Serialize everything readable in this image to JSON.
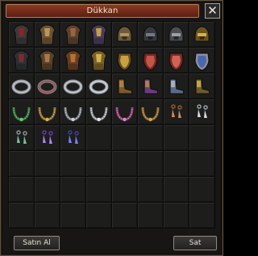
{
  "window": {
    "title": "Dükkan",
    "close_glyph": "✕"
  },
  "buttons": {
    "buy_label": "Satın Al",
    "sell_label": "Sat"
  },
  "grid": {
    "columns": 8,
    "rows": 8,
    "items": [
      {
        "name": "dark-armor-icon",
        "kind": "armor",
        "palette": [
          "#3a3a3c",
          "#a21f1f"
        ]
      },
      {
        "name": "bronze-armor-icon",
        "kind": "armor",
        "palette": [
          "#6e5332",
          "#c7a265"
        ]
      },
      {
        "name": "brown-armor-icon",
        "kind": "armor",
        "palette": [
          "#5b4130",
          "#a66c3c"
        ]
      },
      {
        "name": "gold-armor-icon",
        "kind": "armor",
        "palette": [
          "#4b3b5c",
          "#d8b04a"
        ]
      },
      {
        "name": "bronze-helmet-icon",
        "kind": "helmet",
        "palette": [
          "#6d5a3a",
          "#b99a5e"
        ]
      },
      {
        "name": "dark-helmet-icon",
        "kind": "helmet",
        "palette": [
          "#37383d",
          "#7c7f86"
        ]
      },
      {
        "name": "grey-helmet-icon",
        "kind": "helmet",
        "palette": [
          "#4b4d52",
          "#a7a9ad"
        ]
      },
      {
        "name": "gold-helmet-icon",
        "kind": "helmet",
        "palette": [
          "#6b5320",
          "#e3bb47"
        ]
      },
      {
        "name": "dark-armor-icon",
        "kind": "armor",
        "palette": [
          "#2f3036",
          "#8b2c2c"
        ]
      },
      {
        "name": "bronze-armor-icon",
        "kind": "armor",
        "palette": [
          "#5a4128",
          "#b38451"
        ]
      },
      {
        "name": "copper-armor-icon",
        "kind": "armor",
        "palette": [
          "#6a3d22",
          "#c27a3a"
        ]
      },
      {
        "name": "gold-armor-icon",
        "kind": "armor",
        "palette": [
          "#7a6028",
          "#e2c25a"
        ]
      },
      {
        "name": "gold-shield-icon",
        "kind": "shield",
        "palette": [
          "#6a4e1d",
          "#d9b04a"
        ]
      },
      {
        "name": "red-shield-icon",
        "kind": "shield",
        "palette": [
          "#7a2422",
          "#cf5f4e"
        ]
      },
      {
        "name": "crimson-shield-icon",
        "kind": "shield",
        "palette": [
          "#7b2a24",
          "#e06d5f"
        ]
      },
      {
        "name": "silver-shield-icon",
        "kind": "shield",
        "palette": [
          "#8b8f99",
          "#3f5fb5"
        ]
      },
      {
        "name": "silver-bracelet-icon",
        "kind": "bracelet",
        "palette": [
          "#8f949b",
          "#c6cbd2"
        ]
      },
      {
        "name": "gem-bracelet-icon",
        "kind": "bracelet",
        "palette": [
          "#7c7f86",
          "#b24444"
        ]
      },
      {
        "name": "silver-bracelet-icon",
        "kind": "bracelet",
        "palette": [
          "#8b9096",
          "#d1d5db"
        ]
      },
      {
        "name": "silver-bracelet-icon",
        "kind": "bracelet",
        "palette": [
          "#9aa0a6",
          "#dadde2"
        ]
      },
      {
        "name": "leather-shoes-icon",
        "kind": "shoes",
        "palette": [
          "#7a5a2e",
          "#b8863c"
        ]
      },
      {
        "name": "purple-shoes-icon",
        "kind": "shoes",
        "palette": [
          "#6b3b7d",
          "#c18a3b"
        ]
      },
      {
        "name": "blue-shoes-icon",
        "kind": "shoes",
        "palette": [
          "#596b86",
          "#b5b8bf"
        ]
      },
      {
        "name": "gold-shoes-icon",
        "kind": "shoes",
        "palette": [
          "#6b5b2c",
          "#d2b24a"
        ]
      },
      {
        "name": "green-necklace-icon",
        "kind": "necklace",
        "palette": [
          "#2f7a3a",
          "#79c07a"
        ]
      },
      {
        "name": "gold-necklace-icon",
        "kind": "necklace",
        "palette": [
          "#8b6c2a",
          "#d7b45c"
        ]
      },
      {
        "name": "silver-necklace-icon",
        "kind": "necklace",
        "palette": [
          "#7c8087",
          "#cdd1d6"
        ]
      },
      {
        "name": "pearl-necklace-icon",
        "kind": "necklace",
        "palette": [
          "#8a8f96",
          "#e7e9ee"
        ]
      },
      {
        "name": "pink-necklace-icon",
        "kind": "necklace",
        "palette": [
          "#8d3f76",
          "#d58ac0"
        ]
      },
      {
        "name": "amber-necklace-icon",
        "kind": "necklace",
        "palette": [
          "#8b6a2e",
          "#d2a75a"
        ]
      },
      {
        "name": "copper-earring-icon",
        "kind": "earring",
        "palette": [
          "#8f5b34",
          "#d8955b"
        ]
      },
      {
        "name": "silver-earring-icon",
        "kind": "earring",
        "palette": [
          "#9aa0a6",
          "#e3e6ea"
        ]
      },
      {
        "name": "jade-earring-icon",
        "kind": "earring",
        "palette": [
          "#8a8f95",
          "#7dc8a0"
        ]
      },
      {
        "name": "amethyst-earring-icon",
        "kind": "earring",
        "palette": [
          "#5a3da3",
          "#b48aff"
        ]
      },
      {
        "name": "sapphire-earring-icon",
        "kind": "earring",
        "palette": [
          "#3c3f9c",
          "#7c86ff"
        ]
      }
    ]
  }
}
